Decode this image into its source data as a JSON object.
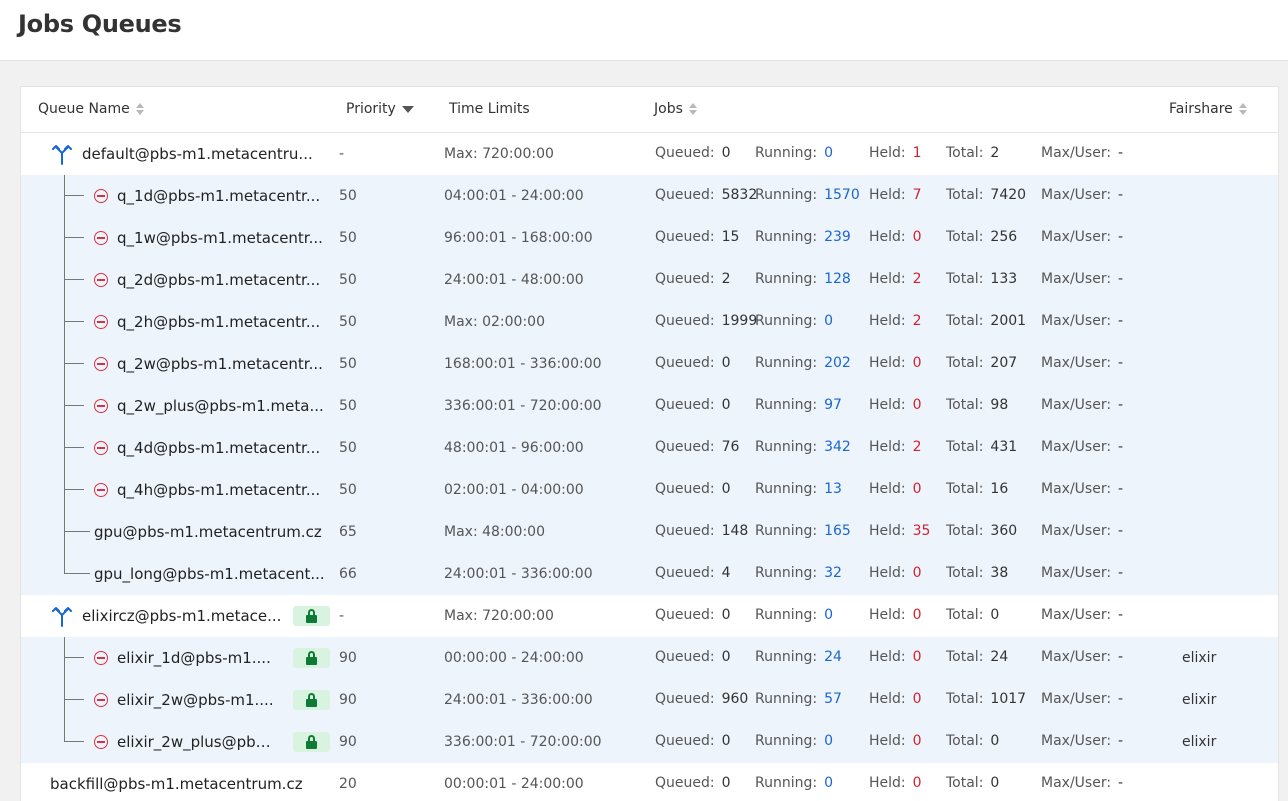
{
  "page": {
    "title": "Jobs Queues"
  },
  "table": {
    "headers": {
      "queue_name": "Queue Name",
      "priority": "Priority",
      "time_limits": "Time Limits",
      "jobs": "Jobs",
      "fairshare": "Fairshare"
    },
    "job_labels": {
      "queued": "Queued:",
      "running": "Running:",
      "held": "Held:",
      "total": "Total:",
      "max_user": "Max/User:"
    },
    "rows": [
      {
        "name": "default@pbs-m1.metacentru...",
        "priority": "-",
        "limits": "Max: 720:00:00",
        "queued": "0",
        "running": "0",
        "held": "1",
        "total": "2",
        "max_user": "-",
        "fairshare": ""
      },
      {
        "name": "q_1d@pbs-m1.metacentr...",
        "priority": "50",
        "limits": "04:00:01 - 24:00:00",
        "queued": "5832",
        "running": "1570",
        "held": "7",
        "total": "7420",
        "max_user": "-",
        "fairshare": ""
      },
      {
        "name": "q_1w@pbs-m1.metacentr...",
        "priority": "50",
        "limits": "96:00:01 - 168:00:00",
        "queued": "15",
        "running": "239",
        "held": "0",
        "total": "256",
        "max_user": "-",
        "fairshare": ""
      },
      {
        "name": "q_2d@pbs-m1.metacentr...",
        "priority": "50",
        "limits": "24:00:01 - 48:00:00",
        "queued": "2",
        "running": "128",
        "held": "2",
        "total": "133",
        "max_user": "-",
        "fairshare": ""
      },
      {
        "name": "q_2h@pbs-m1.metacentr...",
        "priority": "50",
        "limits": "Max: 02:00:00",
        "queued": "1999",
        "running": "0",
        "held": "2",
        "total": "2001",
        "max_user": "-",
        "fairshare": ""
      },
      {
        "name": "q_2w@pbs-m1.metacentr...",
        "priority": "50",
        "limits": "168:00:01 - 336:00:00",
        "queued": "0",
        "running": "202",
        "held": "0",
        "total": "207",
        "max_user": "-",
        "fairshare": ""
      },
      {
        "name": "q_2w_plus@pbs-m1.meta...",
        "priority": "50",
        "limits": "336:00:01 - 720:00:00",
        "queued": "0",
        "running": "97",
        "held": "0",
        "total": "98",
        "max_user": "-",
        "fairshare": ""
      },
      {
        "name": "q_4d@pbs-m1.metacentr...",
        "priority": "50",
        "limits": "48:00:01 - 96:00:00",
        "queued": "76",
        "running": "342",
        "held": "2",
        "total": "431",
        "max_user": "-",
        "fairshare": ""
      },
      {
        "name": "q_4h@pbs-m1.metacentr...",
        "priority": "50",
        "limits": "02:00:01 - 04:00:00",
        "queued": "0",
        "running": "13",
        "held": "0",
        "total": "16",
        "max_user": "-",
        "fairshare": ""
      },
      {
        "name": "gpu@pbs-m1.metacentrum.cz",
        "priority": "65",
        "limits": "Max: 48:00:00",
        "queued": "148",
        "running": "165",
        "held": "35",
        "total": "360",
        "max_user": "-",
        "fairshare": ""
      },
      {
        "name": "gpu_long@pbs-m1.metacent...",
        "priority": "66",
        "limits": "24:00:01 - 336:00:00",
        "queued": "4",
        "running": "32",
        "held": "0",
        "total": "38",
        "max_user": "-",
        "fairshare": ""
      },
      {
        "name": "elixircz@pbs-m1.metace...",
        "priority": "-",
        "limits": "Max: 720:00:00",
        "queued": "0",
        "running": "0",
        "held": "0",
        "total": "0",
        "max_user": "-",
        "fairshare": ""
      },
      {
        "name": "elixir_1d@pbs-m1....",
        "priority": "90",
        "limits": "00:00:00 - 24:00:00",
        "queued": "0",
        "running": "24",
        "held": "0",
        "total": "24",
        "max_user": "-",
        "fairshare": "elixir"
      },
      {
        "name": "elixir_2w@pbs-m1....",
        "priority": "90",
        "limits": "24:00:01 - 336:00:00",
        "queued": "960",
        "running": "57",
        "held": "0",
        "total": "1017",
        "max_user": "-",
        "fairshare": "elixir"
      },
      {
        "name": "elixir_2w_plus@pbs...",
        "priority": "90",
        "limits": "336:00:01 - 720:00:00",
        "queued": "0",
        "running": "0",
        "held": "0",
        "total": "0",
        "max_user": "-",
        "fairshare": "elixir"
      },
      {
        "name": "backfill@pbs-m1.metacentrum.cz",
        "priority": "20",
        "limits": "00:00:01 - 24:00:00",
        "queued": "0",
        "running": "0",
        "held": "0",
        "total": "0",
        "max_user": "-",
        "fairshare": ""
      }
    ]
  },
  "colors": {
    "running": "#1a66d2",
    "held": "#d0232e",
    "child_row_bg": "#eef4fc",
    "lock_badge": "#d8f3df"
  }
}
